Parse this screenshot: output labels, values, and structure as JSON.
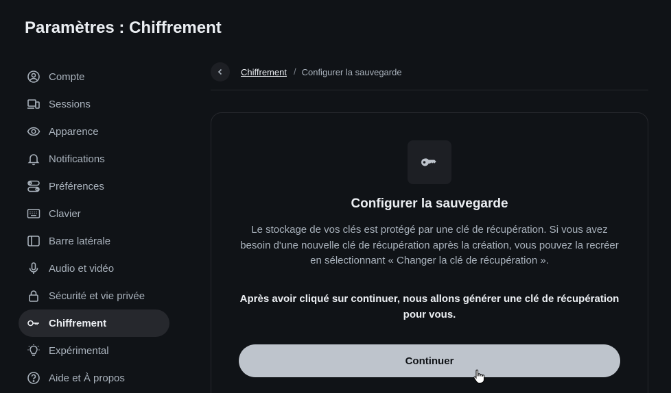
{
  "header": {
    "title_bold": "Paramètres :",
    "title_rest": "Chiffrement"
  },
  "sidebar": {
    "items": [
      {
        "label": "Compte",
        "icon": "user-icon"
      },
      {
        "label": "Sessions",
        "icon": "devices-icon"
      },
      {
        "label": "Apparence",
        "icon": "eye-icon"
      },
      {
        "label": "Notifications",
        "icon": "bell-icon"
      },
      {
        "label": "Préférences",
        "icon": "toggles-icon"
      },
      {
        "label": "Clavier",
        "icon": "keyboard-icon"
      },
      {
        "label": "Barre latérale",
        "icon": "sidebar-icon"
      },
      {
        "label": "Audio et vidéo",
        "icon": "microphone-icon"
      },
      {
        "label": "Sécurité et vie privée",
        "icon": "lock-icon"
      },
      {
        "label": "Chiffrement",
        "icon": "key-icon",
        "active": true
      },
      {
        "label": "Expérimental",
        "icon": "lightbulb-icon"
      },
      {
        "label": "Aide et À propos",
        "icon": "help-icon"
      }
    ]
  },
  "breadcrumb": {
    "parent": "Chiffrement",
    "separator": "/",
    "current": "Configurer la sauvegarde"
  },
  "card": {
    "icon": "key-icon",
    "title": "Configurer la sauvegarde",
    "description": "Le stockage de vos clés est protégé par une clé de récupération. Si vous avez besoin d'une nouvelle clé de récupération après la création, vous pouvez la recréer en sélectionnant « Changer la clé de récupération ».",
    "note": "Après avoir cliqué sur continuer, nous allons générer une clé de récupération pour vous.",
    "continue_label": "Continuer"
  },
  "colors": {
    "background": "#101317",
    "active_nav": "#26282d",
    "button": "#bec4cc",
    "text_primary": "#ebeef2",
    "text_secondary": "#a9b2bc"
  }
}
